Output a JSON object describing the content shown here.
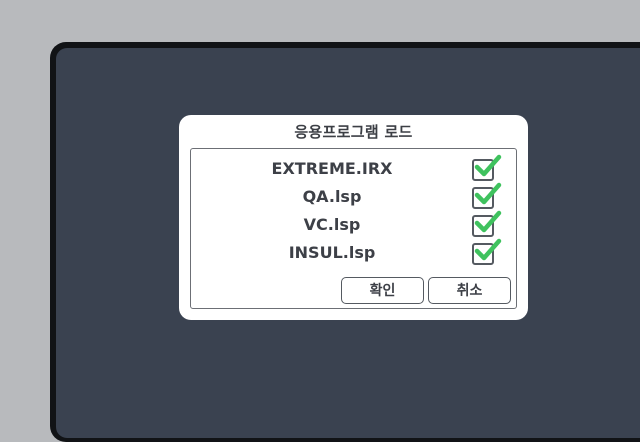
{
  "dialog": {
    "title": "응용프로그램 로드",
    "items": [
      {
        "label": "EXTREME.IRX",
        "checked": true
      },
      {
        "label": "QA.lsp",
        "checked": true
      },
      {
        "label": "VC.lsp",
        "checked": true
      },
      {
        "label": "INSUL.lsp",
        "checked": true
      }
    ],
    "ok_label": "확인",
    "cancel_label": "취소"
  },
  "colors": {
    "check_mark": "#3fc25e",
    "desktop_bg": "#3a4250",
    "frame": "#111316",
    "outer_bg": "#b8babd"
  },
  "icons": {
    "checkbox": "check-icon"
  }
}
